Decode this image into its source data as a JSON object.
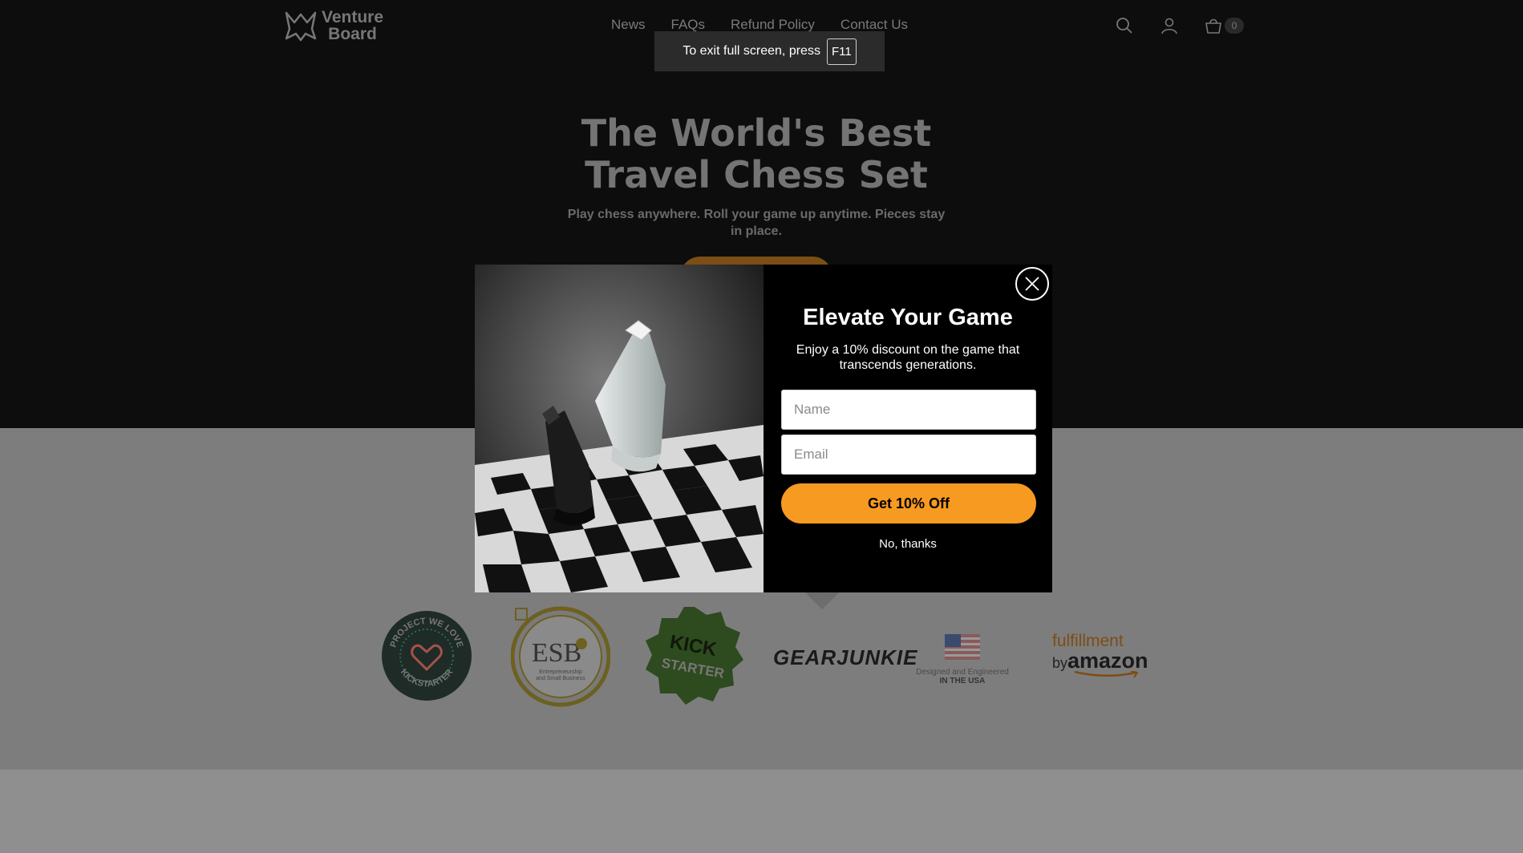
{
  "brand": {
    "line1": "Venture",
    "line2": "Board"
  },
  "nav": {
    "items": [
      "News",
      "FAQs",
      "Refund Policy",
      "Contact Us"
    ]
  },
  "header": {
    "cart_count": "0"
  },
  "fullscreen_notice": {
    "text": "To exit full screen, press",
    "key": "F11"
  },
  "hero": {
    "title_line1": "The World's Best",
    "title_line2": "Travel Chess Set",
    "subtitle": "Play chess anywhere. Roll your game up anytime. Pieces stay in place."
  },
  "badges": {
    "kickstarter_love": {
      "top": "PROJECT WE LOVE",
      "bottom": "KICKSTARTER"
    },
    "esb": {
      "main": "ESB",
      "sub1": "Entrepreneurship",
      "sub2": "and Small Business"
    },
    "kick_starter": {
      "line1": "KICK",
      "line2": "STARTER"
    },
    "gearjunkie": "GEARJUNKIE",
    "usa": {
      "line1": "Designed and Engineered",
      "line2": "IN THE USA"
    },
    "amazon": {
      "line1": "fulfillment",
      "line2a": "by",
      "line2b": "amazon"
    }
  },
  "modal": {
    "title": "Elevate Your Game",
    "description": "Enjoy a 10% discount on the game that transcends generations.",
    "name_placeholder": "Name",
    "email_placeholder": "Email",
    "cta": "Get 10% Off",
    "decline": "No, thanks"
  },
  "colors": {
    "accent": "#f79a22",
    "modal_bg": "#000000",
    "hero_bg": "#0d0d0d"
  }
}
